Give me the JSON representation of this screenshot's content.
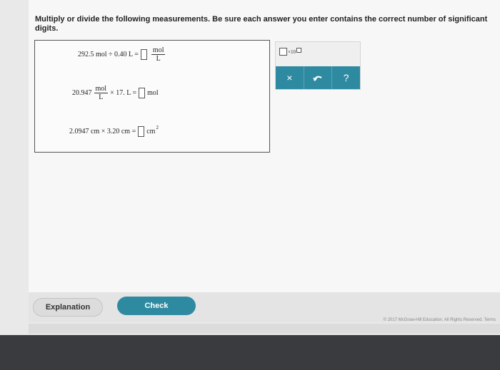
{
  "instructions": "Multiply or divide the following measurements. Be sure each answer you enter contains the correct number of significant digits.",
  "problems": {
    "p1": {
      "expr": "292.5 mol ÷ 0.40 L =",
      "unit_num": "mol",
      "unit_den": "L"
    },
    "p2": {
      "coef": "20.947",
      "unit_num": "mol",
      "unit_den": "L",
      "rest": "× 17. L =",
      "answer_unit": "mol"
    },
    "p3": {
      "expr": "2.0947 cm × 3.20 cm =",
      "answer_unit": "cm",
      "exponent": "2"
    }
  },
  "tools": {
    "sci_label": "×10",
    "clear_label": "×",
    "undo_icon": "undo-icon",
    "help_label": "?"
  },
  "footer": {
    "explanation": "Explanation",
    "check": "Check",
    "copyright": "© 2017 McGraw-Hill Education. All Rights Reserved.   Terms"
  },
  "colors": {
    "accent": "#2e8aa1"
  }
}
